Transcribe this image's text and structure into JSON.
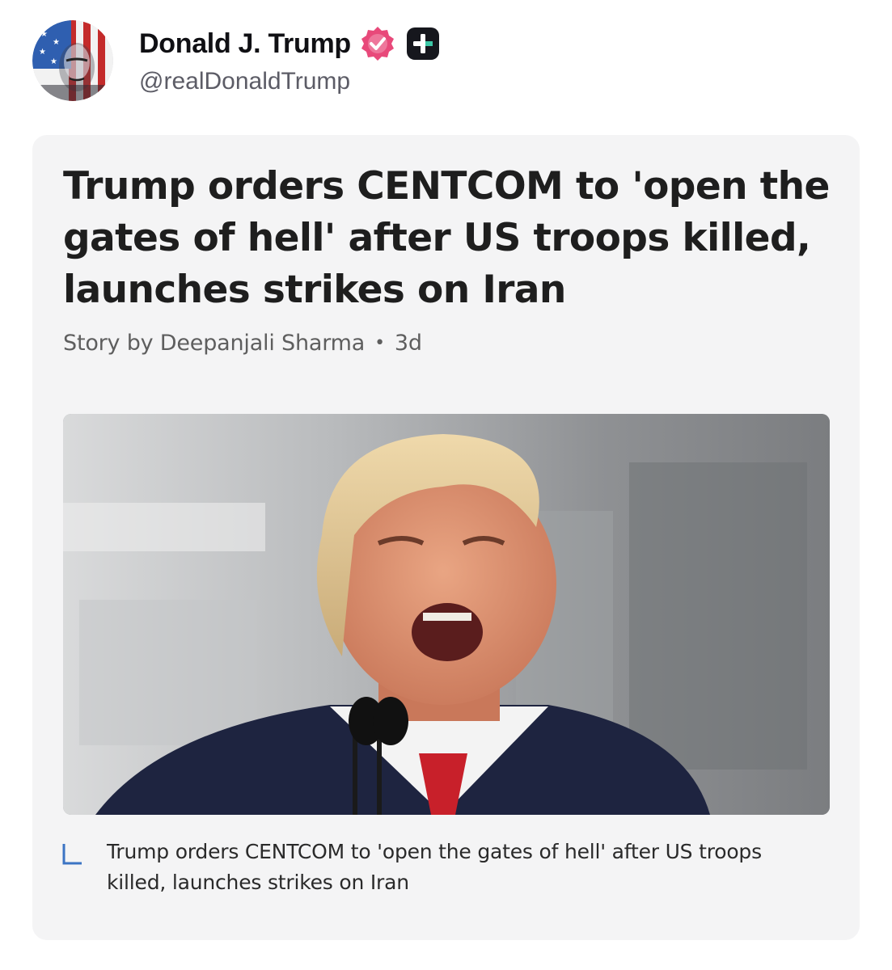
{
  "author": {
    "display_name": "Donald J. Trump",
    "handle": "@realDonaldTrump",
    "avatar_icon": "flag-portrait-avatar",
    "verified_icon": "verified-badge-icon",
    "badge_icon": "plus-badge-icon",
    "verified_color": "#e8497a"
  },
  "card": {
    "headline": "Trump orders CENTCOM to 'open the gates of hell' after US troops killed, launches strikes on Iran",
    "byline": {
      "story_by": "Story by Deepanjali Sharma",
      "separator": "•",
      "age": "3d"
    },
    "image_icon": "news-photo",
    "caption_icon": "reply-corner-icon",
    "caption": "Trump orders CENTCOM to 'open the gates of hell' after US troops killed, launches strikes on Iran"
  }
}
